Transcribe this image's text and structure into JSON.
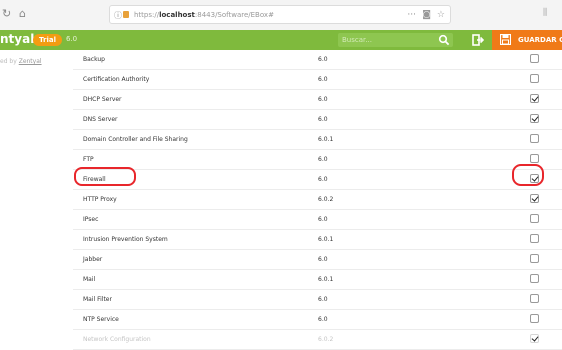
{
  "browser": {
    "url_scheme": "https://",
    "url_host": "localhost",
    "url_rest": ":8443/Software/EBox#",
    "more_glyph": "···"
  },
  "header": {
    "logo": "ntyal",
    "badge": "Trial",
    "version": "6.0",
    "search_placeholder": "Buscar...",
    "save_label": "GUARDAR C",
    "color": "#7fba3d",
    "save_color": "#f07a18"
  },
  "sidebar": {
    "caption_prefix": "ed by",
    "caption_link": "Zentyal"
  },
  "modules": [
    {
      "name": "Backup",
      "version": "6.0",
      "enabled": false,
      "faded": false
    },
    {
      "name": "Certification Authority",
      "version": "6.0",
      "enabled": false,
      "faded": false
    },
    {
      "name": "DHCP Server",
      "version": "6.0",
      "enabled": true,
      "faded": false
    },
    {
      "name": "DNS Server",
      "version": "6.0",
      "enabled": true,
      "faded": false
    },
    {
      "name": "Domain Controller and File Sharing",
      "version": "6.0.1",
      "enabled": false,
      "faded": false
    },
    {
      "name": "FTP",
      "version": "6.0",
      "enabled": false,
      "faded": false
    },
    {
      "name": "Firewall",
      "version": "6.0",
      "enabled": true,
      "faded": false
    },
    {
      "name": "HTTP Proxy",
      "version": "6.0.2",
      "enabled": true,
      "faded": false
    },
    {
      "name": "IPsec",
      "version": "6.0",
      "enabled": false,
      "faded": false
    },
    {
      "name": "Intrusion Prevention System",
      "version": "6.0.1",
      "enabled": false,
      "faded": false
    },
    {
      "name": "Jabber",
      "version": "6.0",
      "enabled": false,
      "faded": false
    },
    {
      "name": "Mail",
      "version": "6.0.1",
      "enabled": false,
      "faded": false
    },
    {
      "name": "Mail Filter",
      "version": "6.0",
      "enabled": false,
      "faded": false
    },
    {
      "name": "NTP Service",
      "version": "6.0",
      "enabled": false,
      "faded": false
    },
    {
      "name": "Network Configuration",
      "version": "6.0.2",
      "enabled": true,
      "faded": true
    }
  ]
}
